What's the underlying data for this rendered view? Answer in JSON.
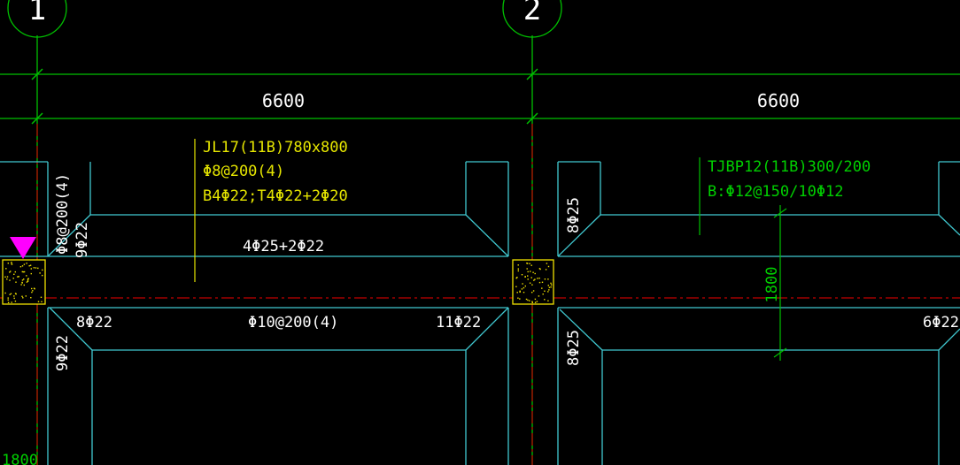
{
  "axes": {
    "left": "1",
    "right": "2"
  },
  "dimensions": {
    "span_left": "6600",
    "span_right": "6600",
    "width_vertical": "1800",
    "width_bottom_left": "1800"
  },
  "beam": {
    "name": "JL17(11B)780x800",
    "stirrup": "Φ8@200(4)",
    "bottom_top": "B4Φ22;T4Φ22+2Φ20",
    "side_top": "4Φ25+2Φ22",
    "stirrup_vertical": "Φ8@200(4)"
  },
  "slab": {
    "name": "TJBP12(11B)300/200",
    "reinf": "B:Φ12@150/10Φ12"
  },
  "rebars": {
    "left_upper_vertical": "9Φ22",
    "left_lower_vertical": "9Φ22",
    "mid_upper_vertical": "8Φ25",
    "mid_lower_vertical": "8Φ25",
    "bottom_left": "8Φ22",
    "bottom_mid": "Φ10@200(4)",
    "bottom_right": "11Φ22",
    "far_right": "6Φ22"
  },
  "colors": {
    "background": "#000000",
    "grid_line": "#00c000",
    "dimension_line": "#00d000",
    "beam_outline": "#40c8d0",
    "center_line": "#c00000",
    "annotation": "#e6e600",
    "column_fill": "#f0e000",
    "marker": "#ff00ff"
  }
}
